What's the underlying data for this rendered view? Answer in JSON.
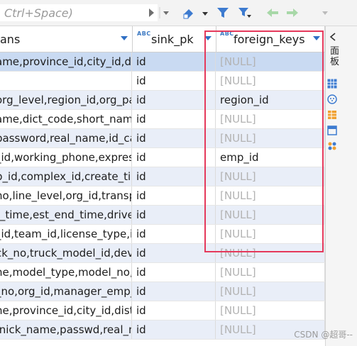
{
  "filter": {
    "placeholder": "Ctrl+Space)"
  },
  "columns": [
    {
      "label": "ans",
      "type_badge": ""
    },
    {
      "label": "sink_pk",
      "type_badge": "ABC"
    },
    {
      "label": "foreign_keys",
      "type_badge": "ABC"
    }
  ],
  "rows": [
    {
      "columns": "ame,province_id,city_id,dis",
      "sink_pk": "id",
      "foreign_keys": "[NULL]",
      "state": "selected"
    },
    {
      "columns": "",
      "sink_pk": "id",
      "foreign_keys": "[NULL]",
      "state": "normal"
    },
    {
      "columns": "org_level,region_id,org_pare",
      "sink_pk": "id",
      "foreign_keys": "region_id",
      "state": "alt"
    },
    {
      "columns": "ame,dict_code,short_name",
      "sink_pk": "id",
      "foreign_keys": "[NULL]",
      "state": "normal"
    },
    {
      "columns": "password,real_name,id_card",
      "sink_pk": "id",
      "foreign_keys": "[NULL]",
      "state": "alt"
    },
    {
      "columns": "_id,working_phone,express",
      "sink_pk": "id",
      "foreign_keys": "emp_id",
      "state": "normal"
    },
    {
      "columns": "p_id,complex_id,create_tim",
      "sink_pk": "id",
      "foreign_keys": "[NULL]",
      "state": "alt"
    },
    {
      "columns": "no,line_level,org_id,transpo",
      "sink_pk": "id",
      "foreign_keys": "[NULL]",
      "state": "normal"
    },
    {
      "columns": "t_time,est_end_time,driver",
      "sink_pk": "id",
      "foreign_keys": "[NULL]",
      "state": "alt"
    },
    {
      "columns": "_id,team_id,license_type,in",
      "sink_pk": "id",
      "foreign_keys": "[NULL]",
      "state": "normal"
    },
    {
      "columns": "ck_no,truck_model_id,devi",
      "sink_pk": "id",
      "foreign_keys": "[NULL]",
      "state": "alt"
    },
    {
      "columns": "ne,model_type,model_no,b",
      "sink_pk": "id",
      "foreign_keys": "[NULL]",
      "state": "normal"
    },
    {
      "columns": "_no,org_id,manager_emp_i",
      "sink_pk": "id",
      "foreign_keys": "[NULL]",
      "state": "alt"
    },
    {
      "columns": "ne,province_id,city_id,dist",
      "sink_pk": "id",
      "foreign_keys": "[NULL]",
      "state": "normal"
    },
    {
      "columns": ",nick_name,passwd,real_na",
      "sink_pk": "id",
      "foreign_keys": "[NULL]",
      "state": "alt"
    }
  ],
  "side_panel": {
    "label": "面板"
  },
  "watermark": "CSDN @超哥--",
  "colors": {
    "highlight": "#e5395b",
    "selected_row": "#c9daf2",
    "alt_row": "#e9eef8",
    "null_text": "#b3b3b3"
  }
}
